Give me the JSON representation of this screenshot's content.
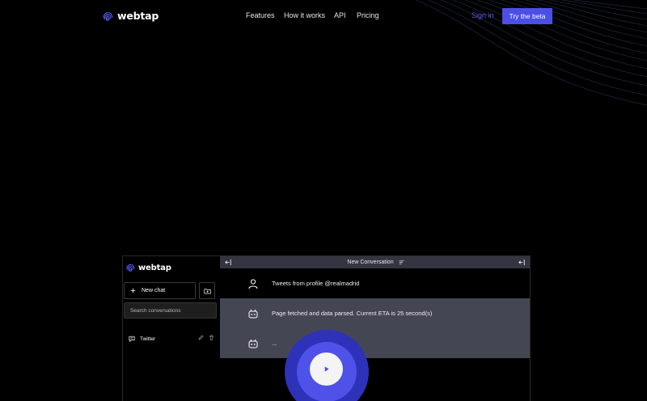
{
  "brand": {
    "name": "webtap",
    "accent": "#4b4fe6"
  },
  "nav": {
    "links": [
      "Features",
      "How it works",
      "API",
      "Pricing"
    ],
    "signin": "Sign in",
    "cta": "Try the beta"
  },
  "app": {
    "sidebar": {
      "brand": "webtap",
      "new_chat": "New chat",
      "search_placeholder": "Search conversations",
      "conversations": [
        "Twitter"
      ]
    },
    "header": {
      "title": "New Conversation"
    },
    "messages": [
      {
        "role": "user",
        "text": "Tweets from profile @realmadrid"
      },
      {
        "role": "bot",
        "text": "Page fetched and data parsed. Current ETA is 25 second(s)"
      },
      {
        "role": "bot",
        "text": "..."
      }
    ]
  },
  "icons": {
    "logo": "fingerprint-logo-icon",
    "play": "play-icon",
    "user": "user-icon",
    "bot": "robot-icon"
  }
}
